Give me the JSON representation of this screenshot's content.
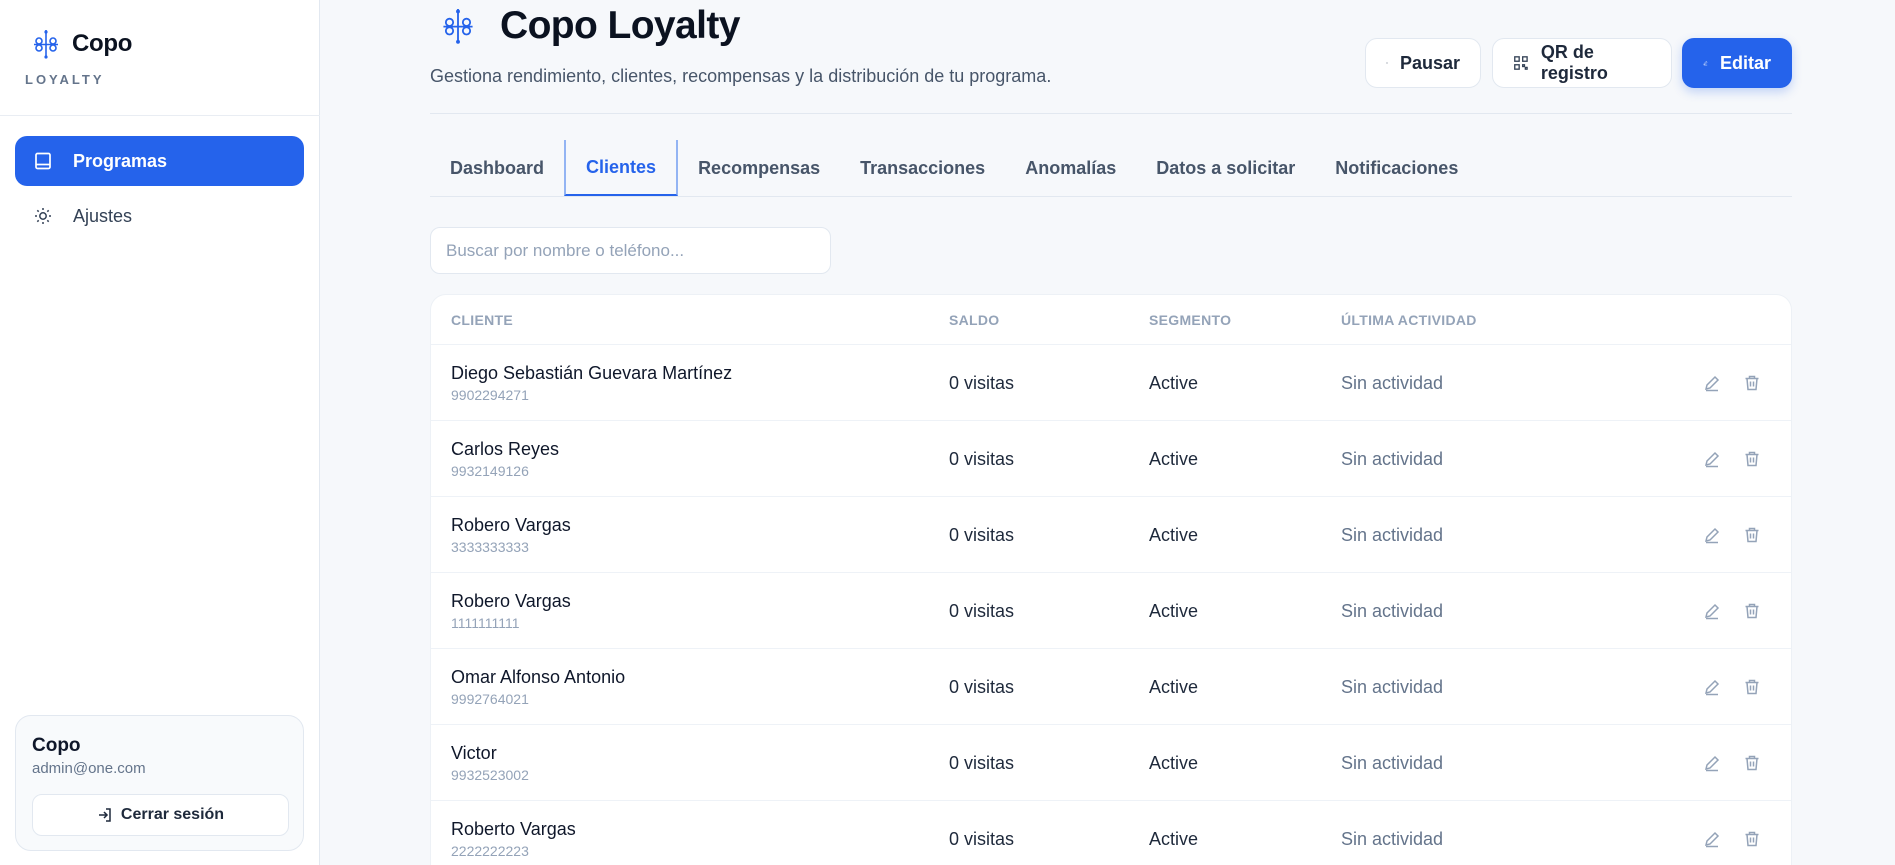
{
  "sidebar": {
    "brand_name": "Copo",
    "brand_sub": "LOYALTY",
    "items": [
      {
        "label": "Programas",
        "icon": "book-icon",
        "active": true
      },
      {
        "label": "Ajustes",
        "icon": "sun-icon",
        "active": false
      }
    ],
    "user": {
      "name": "Copo",
      "email": "admin@one.com",
      "logout_label": "Cerrar sesión"
    }
  },
  "header": {
    "title": "Copo Loyalty",
    "subtitle": "Gestiona rendimiento, clientes, recompensas y la distribución de tu programa.",
    "pause_label": "Pausar",
    "qr_label": "QR de registro",
    "edit_label": "Editar"
  },
  "tabs": [
    {
      "label": "Dashboard",
      "active": false
    },
    {
      "label": "Clientes",
      "active": true
    },
    {
      "label": "Recompensas",
      "active": false
    },
    {
      "label": "Transacciones",
      "active": false
    },
    {
      "label": "Anomalías",
      "active": false
    },
    {
      "label": "Datos a solicitar",
      "active": false
    },
    {
      "label": "Notificaciones",
      "active": false
    }
  ],
  "search": {
    "placeholder": "Buscar por nombre o teléfono...",
    "value": ""
  },
  "table": {
    "headers": {
      "cliente": "CLIENTE",
      "saldo": "SALDO",
      "segmento": "SEGMENTO",
      "actividad": "ÚLTIMA ACTIVIDAD"
    },
    "rows": [
      {
        "name": "Diego Sebastián Guevara Martínez",
        "phone": "9902294271",
        "saldo": "0 visitas",
        "segmento": "Active",
        "actividad": "Sin actividad"
      },
      {
        "name": "Carlos Reyes",
        "phone": "9932149126",
        "saldo": "0 visitas",
        "segmento": "Active",
        "actividad": "Sin actividad"
      },
      {
        "name": "Robero Vargas",
        "phone": "3333333333",
        "saldo": "0 visitas",
        "segmento": "Active",
        "actividad": "Sin actividad"
      },
      {
        "name": "Robero Vargas",
        "phone": "1111111111",
        "saldo": "0 visitas",
        "segmento": "Active",
        "actividad": "Sin actividad"
      },
      {
        "name": "Omar Alfonso Antonio",
        "phone": "9992764021",
        "saldo": "0 visitas",
        "segmento": "Active",
        "actividad": "Sin actividad"
      },
      {
        "name": "Victor",
        "phone": "9932523002",
        "saldo": "0 visitas",
        "segmento": "Active",
        "actividad": "Sin actividad"
      },
      {
        "name": "Roberto Vargas",
        "phone": "2222222223",
        "saldo": "0 visitas",
        "segmento": "Active",
        "actividad": "Sin actividad"
      }
    ]
  },
  "colors": {
    "accent": "#2563eb",
    "text": "#0f172a",
    "muted": "#64748b",
    "border": "#e2e8f0"
  }
}
